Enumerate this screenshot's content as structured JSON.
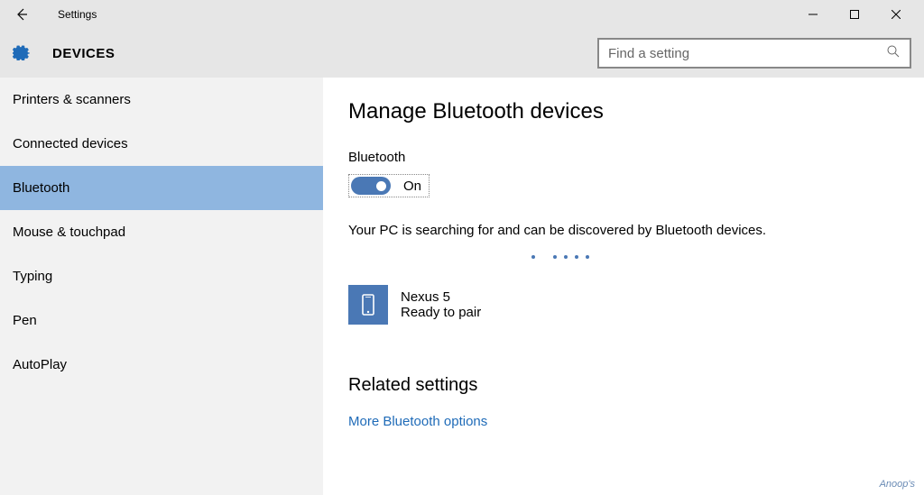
{
  "titlebar": {
    "title": "Settings"
  },
  "header": {
    "label": "DEVICES",
    "search_placeholder": "Find a setting"
  },
  "sidebar": {
    "items": [
      "Printers & scanners",
      "Connected devices",
      "Bluetooth",
      "Mouse & touchpad",
      "Typing",
      "Pen",
      "AutoPlay"
    ],
    "selected_index": 2
  },
  "main": {
    "heading": "Manage Bluetooth devices",
    "bluetooth_label": "Bluetooth",
    "toggle_state": "On",
    "description": "Your PC is searching for and can be discovered by Bluetooth devices.",
    "device": {
      "name": "Nexus 5",
      "status": "Ready to pair",
      "icon": "phone-icon"
    },
    "related_heading": "Related settings",
    "related_link": "More Bluetooth options"
  },
  "watermark": "Anoop's",
  "colors": {
    "accent": "#4a78b5",
    "sidebar_bg": "#f2f2f2",
    "sidebar_selected": "#8fb6e0",
    "header_bg": "#e6e6e6"
  }
}
